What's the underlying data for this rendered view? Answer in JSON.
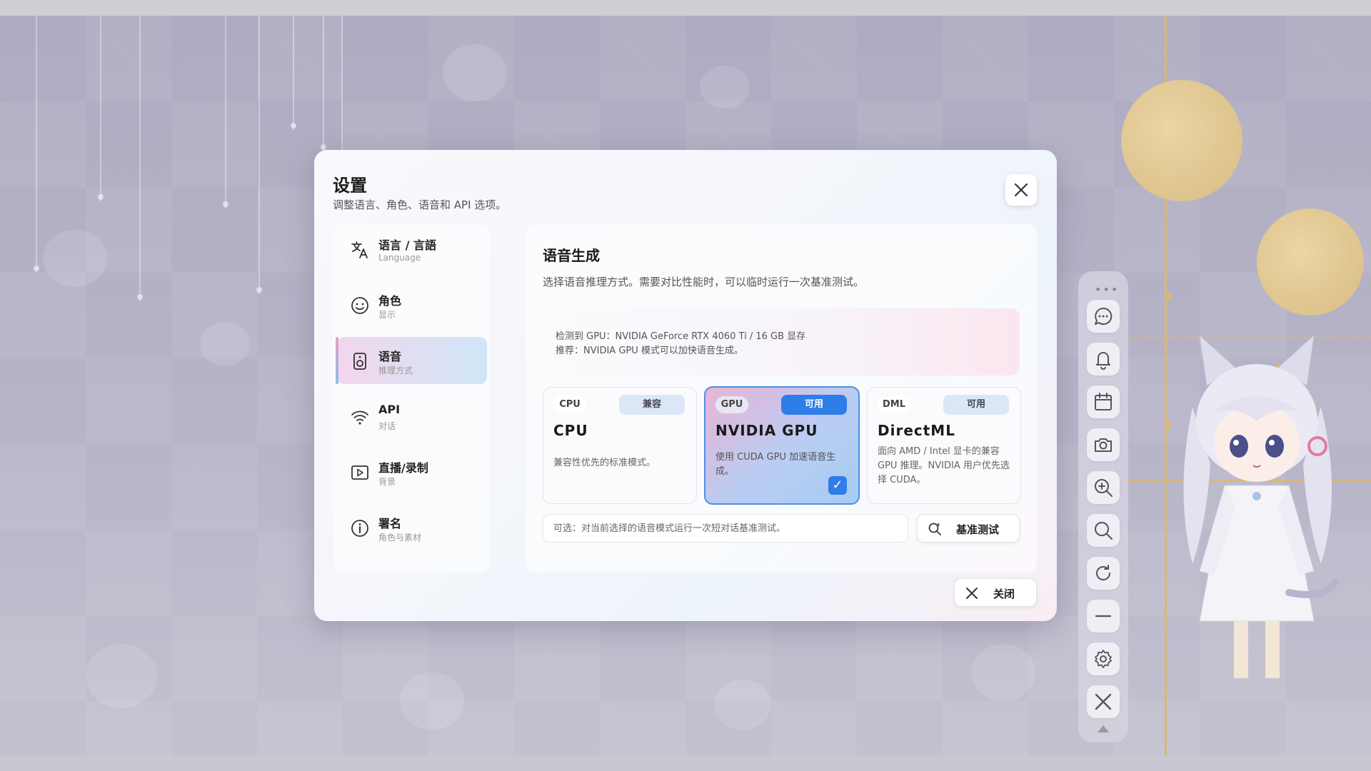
{
  "dialog": {
    "title": "设置",
    "subtitle": "调整语言、角色、语音和 API 选项。",
    "close_icon": "close-icon"
  },
  "sidebar": {
    "items": [
      {
        "label": "语言 / 言語",
        "sub": "Language",
        "icon": "translate-icon"
      },
      {
        "label": "角色",
        "sub": "显示",
        "icon": "smiley-icon"
      },
      {
        "label": "语音",
        "sub": "推理方式",
        "icon": "speaker-icon",
        "active": true
      },
      {
        "label": "API",
        "sub": "对话",
        "icon": "wifi-icon"
      },
      {
        "label": "直播/录制",
        "sub": "背景",
        "icon": "play-icon"
      },
      {
        "label": "署名",
        "sub": "角色与素材",
        "icon": "info-icon"
      }
    ]
  },
  "panel": {
    "title": "语音生成",
    "description": "选择语音推理方式。需要对比性能时，可以临时运行一次基准测试。",
    "gpu_detect": "检测到 GPU：NVIDIA GeForce RTX 4060 Ti / 16 GB 显存",
    "recommend": "推荐：NVIDIA GPU 模式可以加快语音生成。",
    "cards": [
      {
        "tag": "CPU",
        "status": "兼容",
        "name": "CPU",
        "desc": "兼容性优先的标准模式。",
        "selected": false
      },
      {
        "tag": "GPU",
        "status": "可用",
        "name": "NVIDIA GPU",
        "desc": "使用 CUDA GPU 加速语音生成。",
        "selected": true,
        "check": "✓"
      },
      {
        "tag": "DML",
        "status": "可用",
        "name": "DirectML",
        "desc": "面向 AMD / Intel 显卡的兼容 GPU 推理。NVIDIA 用户优先选择 CUDA。",
        "selected": false
      }
    ],
    "bench_hint": "可选：对当前选择的语音模式运行一次短对话基准测试。",
    "bench_button": "基准测试"
  },
  "footer": {
    "close_button": "关闭"
  },
  "toolbar": {
    "dots": "•••",
    "buttons": [
      "chat-icon",
      "bell-icon",
      "calendar-icon",
      "camera-icon",
      "zoom-in-icon",
      "search-icon",
      "refresh-icon",
      "minimize-icon",
      "settings-icon",
      "close-icon"
    ]
  },
  "colors": {
    "accent": "#2f7de6",
    "active_gradient_start": "#f3d6ec",
    "active_gradient_end": "#cfe6f8"
  }
}
